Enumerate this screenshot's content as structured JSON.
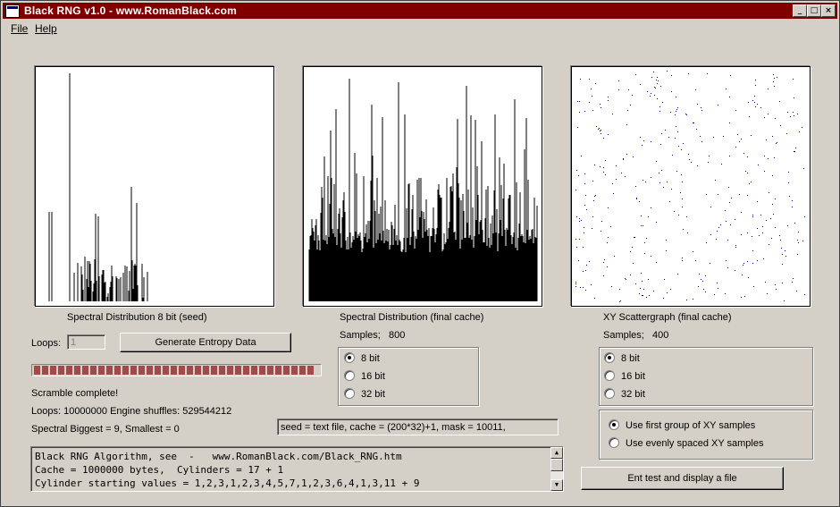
{
  "window": {
    "title": "Black RNG  v1.0  -  www.RomanBlack.com",
    "title_color": "#800000"
  },
  "menu": {
    "file": "File",
    "help": "Help"
  },
  "panels": {
    "spectral_seed_label": "Spectral Distribution 8 bit (seed)",
    "spectral_final_label": "Spectral Distribution (final cache)",
    "scatter_label": "XY Scattergraph (final cache)"
  },
  "controls": {
    "loops_label": "Loops:",
    "loops_value": "1",
    "generate_button": "Generate Entropy Data",
    "progress": 1.0,
    "status_complete": "Scramble complete!",
    "status_loops": "Loops: 10000000  Engine shuffles: 529544212",
    "status_spectral": "Spectral Biggest = 9, Smallest = 0",
    "seed_info": "seed = text file, cache = (200*32)+1, mask = 10011,"
  },
  "spectral_options": {
    "samples_label": "Samples;",
    "samples_value": "800",
    "options": [
      "8 bit",
      "16 bit",
      "32 bit"
    ],
    "selected": 0
  },
  "scatter_options": {
    "samples_label": "Samples;",
    "samples_value": "400",
    "options": [
      "8 bit",
      "16 bit",
      "32 bit"
    ],
    "selected": 0
  },
  "xy_mode": {
    "options": [
      "Use first group of XY samples",
      "Use evenly spaced XY samples"
    ],
    "selected": 0
  },
  "memo": {
    "lines": [
      "Black RNG Algorithm, see  -   www.RomanBlack.com/Black_RNG.htm",
      "Cache = 1000000 bytes,  Cylinders = 17 + 1",
      "Cylinder starting values = 1,2,3,1,2,3,4,5,7,1,2,3,6,4,1,3,11 + 9"
    ]
  },
  "ent_button": "Ent test and display a file",
  "colors": {
    "plot_bar": "#000000",
    "scatter_point": "#000080",
    "progress_segment": "#a04a4a"
  }
}
